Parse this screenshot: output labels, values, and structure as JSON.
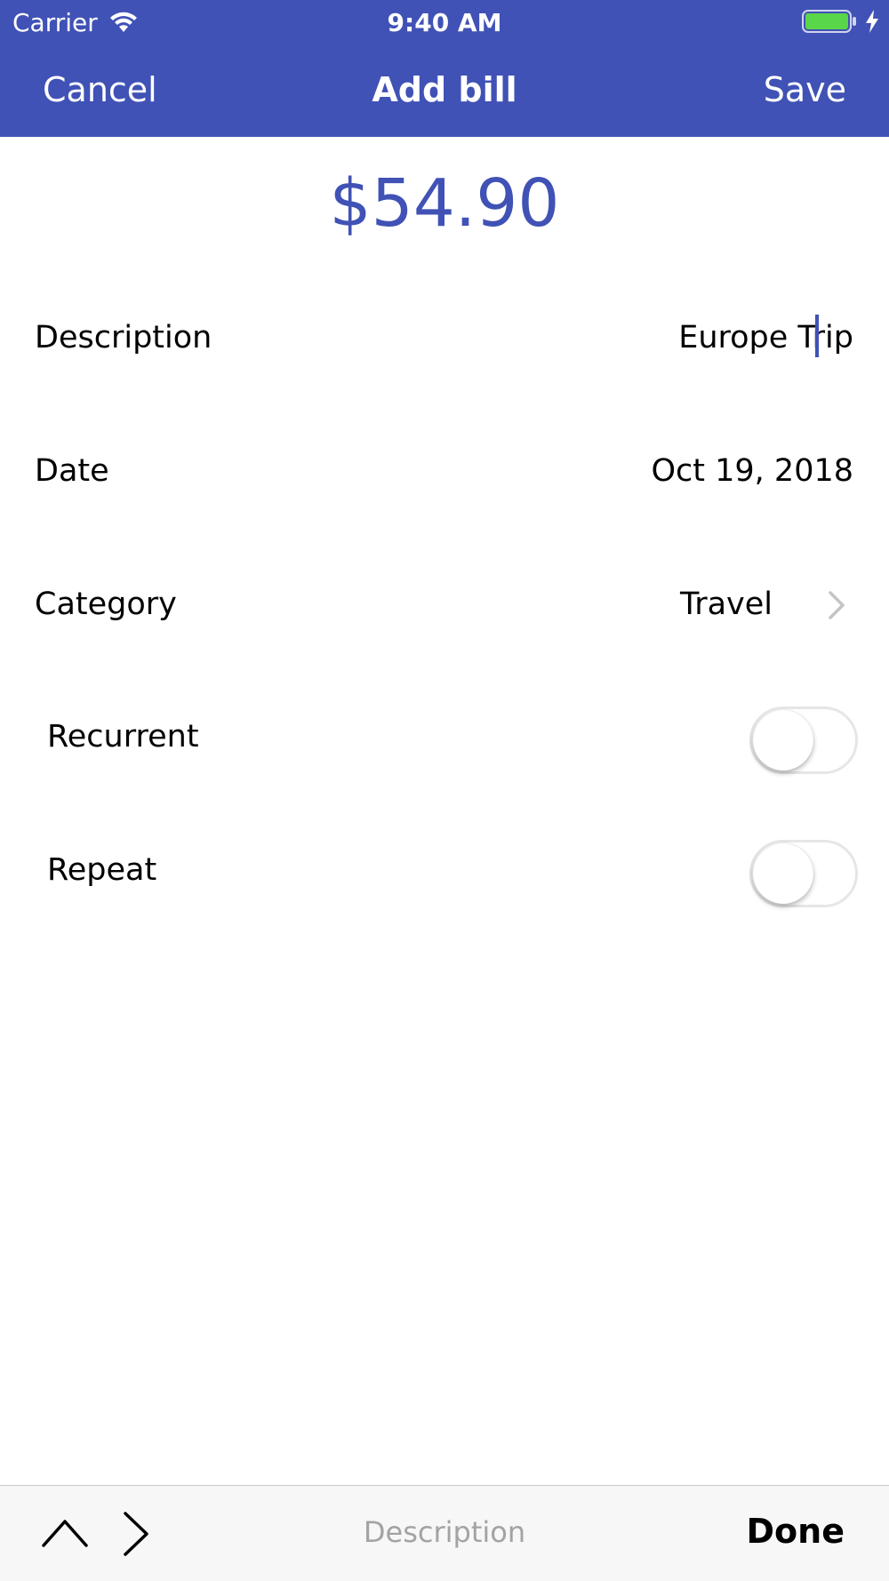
{
  "status_bar": {
    "carrier": "Carrier",
    "time": "9:40 AM",
    "icons": [
      "wifi-icon",
      "battery-icon",
      "charging-icon"
    ],
    "battery_color": "#5ad649"
  },
  "nav": {
    "cancel_label": "Cancel",
    "title": "Add bill",
    "save_label": "Save",
    "background": "#4052b5"
  },
  "amount": "$54.90",
  "rows": {
    "description": {
      "label": "Description",
      "value": "Europe Trip"
    },
    "date": {
      "label": "Date",
      "value": "Oct 19, 2018"
    },
    "category": {
      "label": "Category",
      "value": "Travel",
      "icon": "chevron-right-icon"
    },
    "recurrent": {
      "label": "Recurrent",
      "on": false
    },
    "repeat": {
      "label": "Repeat",
      "on": false
    }
  },
  "accessory": {
    "icons": [
      "chevron-up-icon",
      "chevron-right-icon"
    ],
    "label": "Description",
    "done_label": "Done"
  },
  "colors": {
    "accent": "#4052b5",
    "placeholder": "#a3a3a3"
  }
}
